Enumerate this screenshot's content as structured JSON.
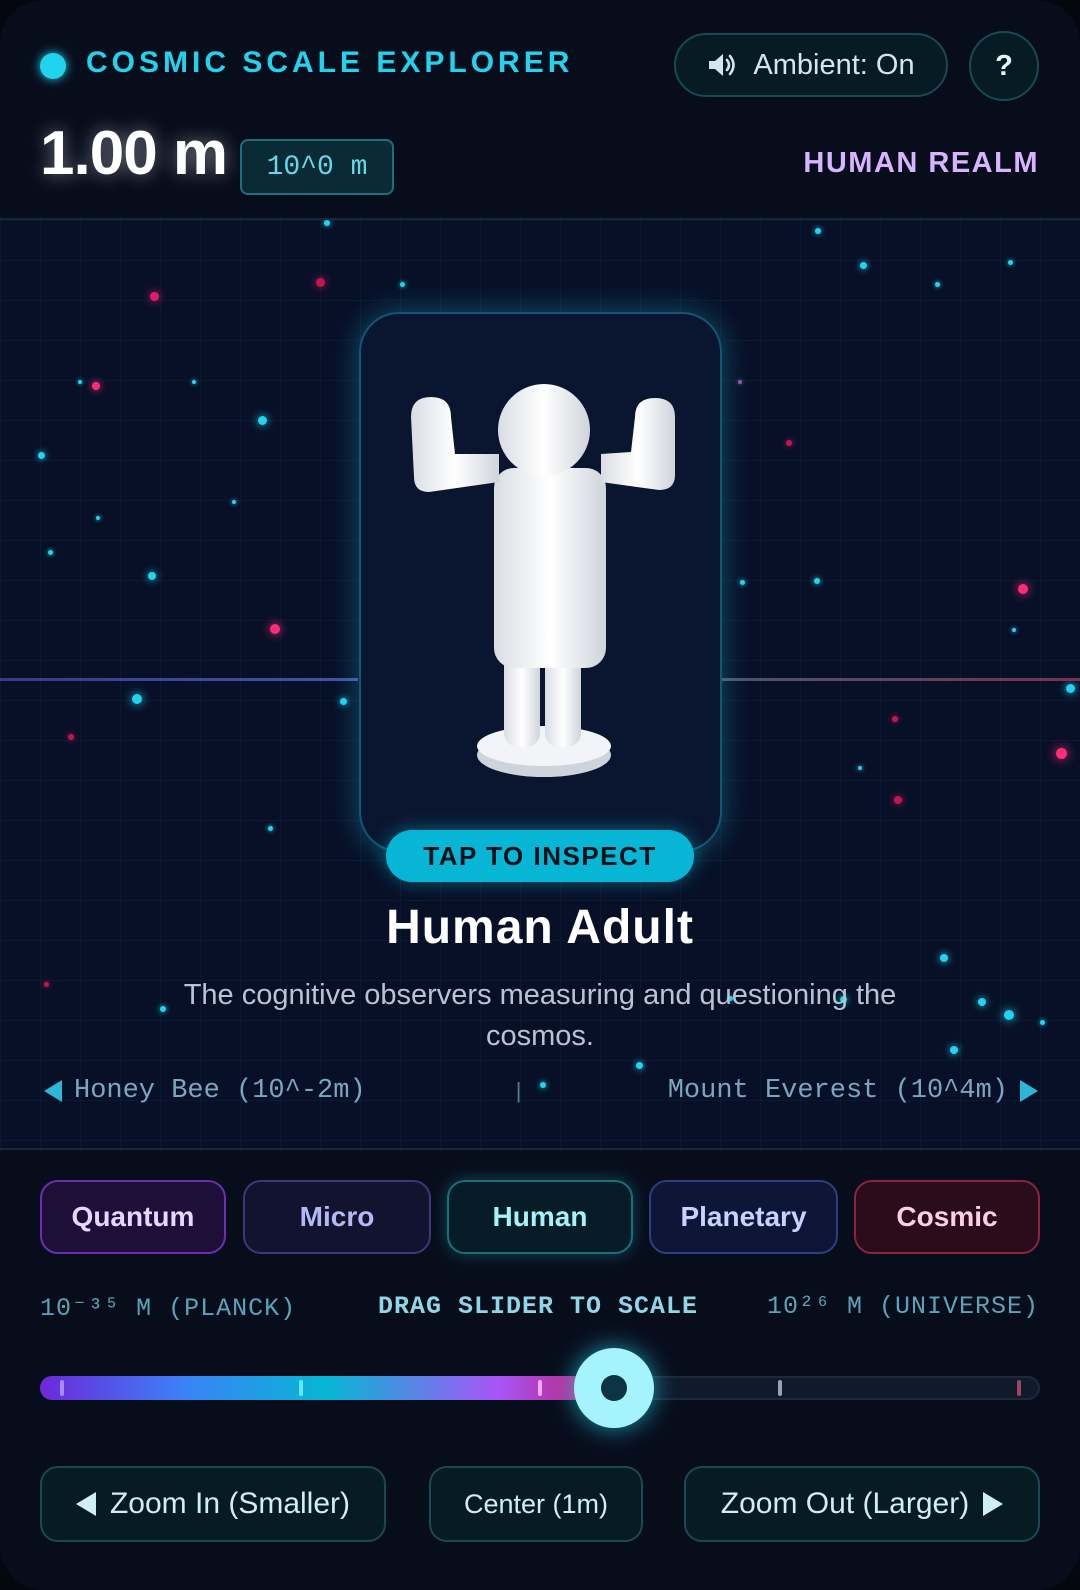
{
  "header": {
    "title": "COSMIC SCALE EXPLORER",
    "ambient_label": "Ambient: On",
    "help_label": "?",
    "scale_value": "1.00 m",
    "power_notation": "10^0 m",
    "realm": "HUMAN REALM"
  },
  "object": {
    "inspect_label": "TAP TO INSPECT",
    "name": "Human Adult",
    "description": "The cognitive observers measuring and questioning the cosmos."
  },
  "neighbors": {
    "previous": "Honey Bee (10^-2m)",
    "separator": "|",
    "next": "Mount Everest (10^4m)"
  },
  "realm_tabs": [
    {
      "label": "Quantum"
    },
    {
      "label": "Micro"
    },
    {
      "label": "Human",
      "active": true
    },
    {
      "label": "Planetary"
    },
    {
      "label": "Cosmic"
    }
  ],
  "slider": {
    "min_label": "10⁻³⁵ M (PLANCK)",
    "hint": "DRAG SLIDER TO SCALE",
    "max_label": "10²⁶ M (UNIVERSE)",
    "min_exponent": -35,
    "max_exponent": 26,
    "current_exponent": 0
  },
  "actions": {
    "zoom_in": "Zoom In (Smaller)",
    "center": "Center (1m)",
    "zoom_out": "Zoom Out (Larger)"
  },
  "colors": {
    "accent": "#22d3ee",
    "realm_label": "#d8b4fe",
    "background": "#070b1a"
  }
}
